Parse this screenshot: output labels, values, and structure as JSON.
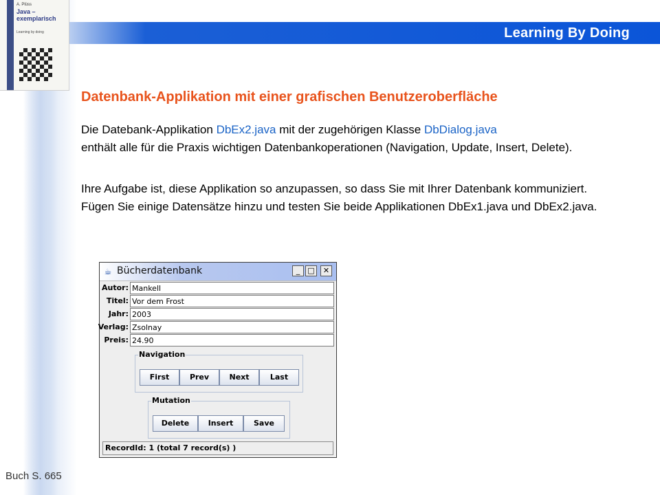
{
  "header": {
    "title": "Learning By Doing"
  },
  "book": {
    "author": "A. Plüss",
    "title_line1": "Java –",
    "title_line2": "exemplarisch",
    "subtitle": "Learning by doing"
  },
  "slide": {
    "title": "Datenbank-Applikation mit einer grafischen Benutzeroberfläche",
    "p1_part1": "Die Datebank-Applikation ",
    "p1_link1": "DbEx2.java",
    "p1_part2": " mit der zugehörigen Klasse ",
    "p1_link2": "DbDialog.java",
    "p1_part3": "enthält alle für die Praxis wichtigen Datenbankoperationen (Navigation, Update, Insert, Delete).",
    "p2": "Ihre Aufgabe ist, diese Applikation so anzupassen, so dass Sie mit Ihrer Datenbank kommuniziert. Fügen Sie einige Datensätze hinzu und testen Sie beide Applikationen DbEx1.java und DbEx2.java.",
    "footer": "Buch S. 665"
  },
  "colors": {
    "header_blue": "#0b55d8",
    "title_orange": "#e8531c",
    "link_blue": "#1a63c6"
  },
  "window": {
    "title": "Bücherdatenbank",
    "app_icon": "java-cup-icon",
    "fields": [
      {
        "label": "Autor:",
        "value": "Mankell"
      },
      {
        "label": "Titel:",
        "value": "Vor dem Frost"
      },
      {
        "label": "Jahr:",
        "value": "2003"
      },
      {
        "label": "Verlag:",
        "value": "Zsolnay"
      },
      {
        "label": "Preis:",
        "value": "24.90"
      }
    ],
    "navigation": {
      "label": "Navigation",
      "buttons": [
        "First",
        "Prev",
        "Next",
        "Last"
      ]
    },
    "mutation": {
      "label": "Mutation",
      "buttons": [
        "Delete",
        "Insert",
        "Save"
      ]
    },
    "status": "RecordId: 1 (total 7 record(s) )"
  }
}
